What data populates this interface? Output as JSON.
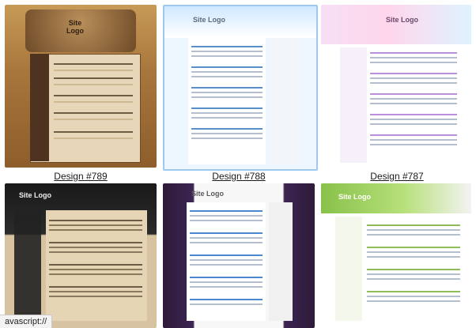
{
  "designs": [
    {
      "label": "Design #789",
      "logo": "Site\nLogo"
    },
    {
      "label": "Design #788",
      "logo": "Site Logo"
    },
    {
      "label": "Design #787",
      "logo": "Site Logo"
    },
    {
      "label": "",
      "logo": "Site Logo"
    },
    {
      "label": "",
      "logo": "Site Logo"
    },
    {
      "label": "",
      "logo": "Site Logo"
    }
  ],
  "status_bar": {
    "text": "avascript://"
  },
  "colors": {
    "selected_border": "#9fc7ef",
    "selected_bg": "#d9ecff",
    "status_bg": "#f3f3f3"
  }
}
